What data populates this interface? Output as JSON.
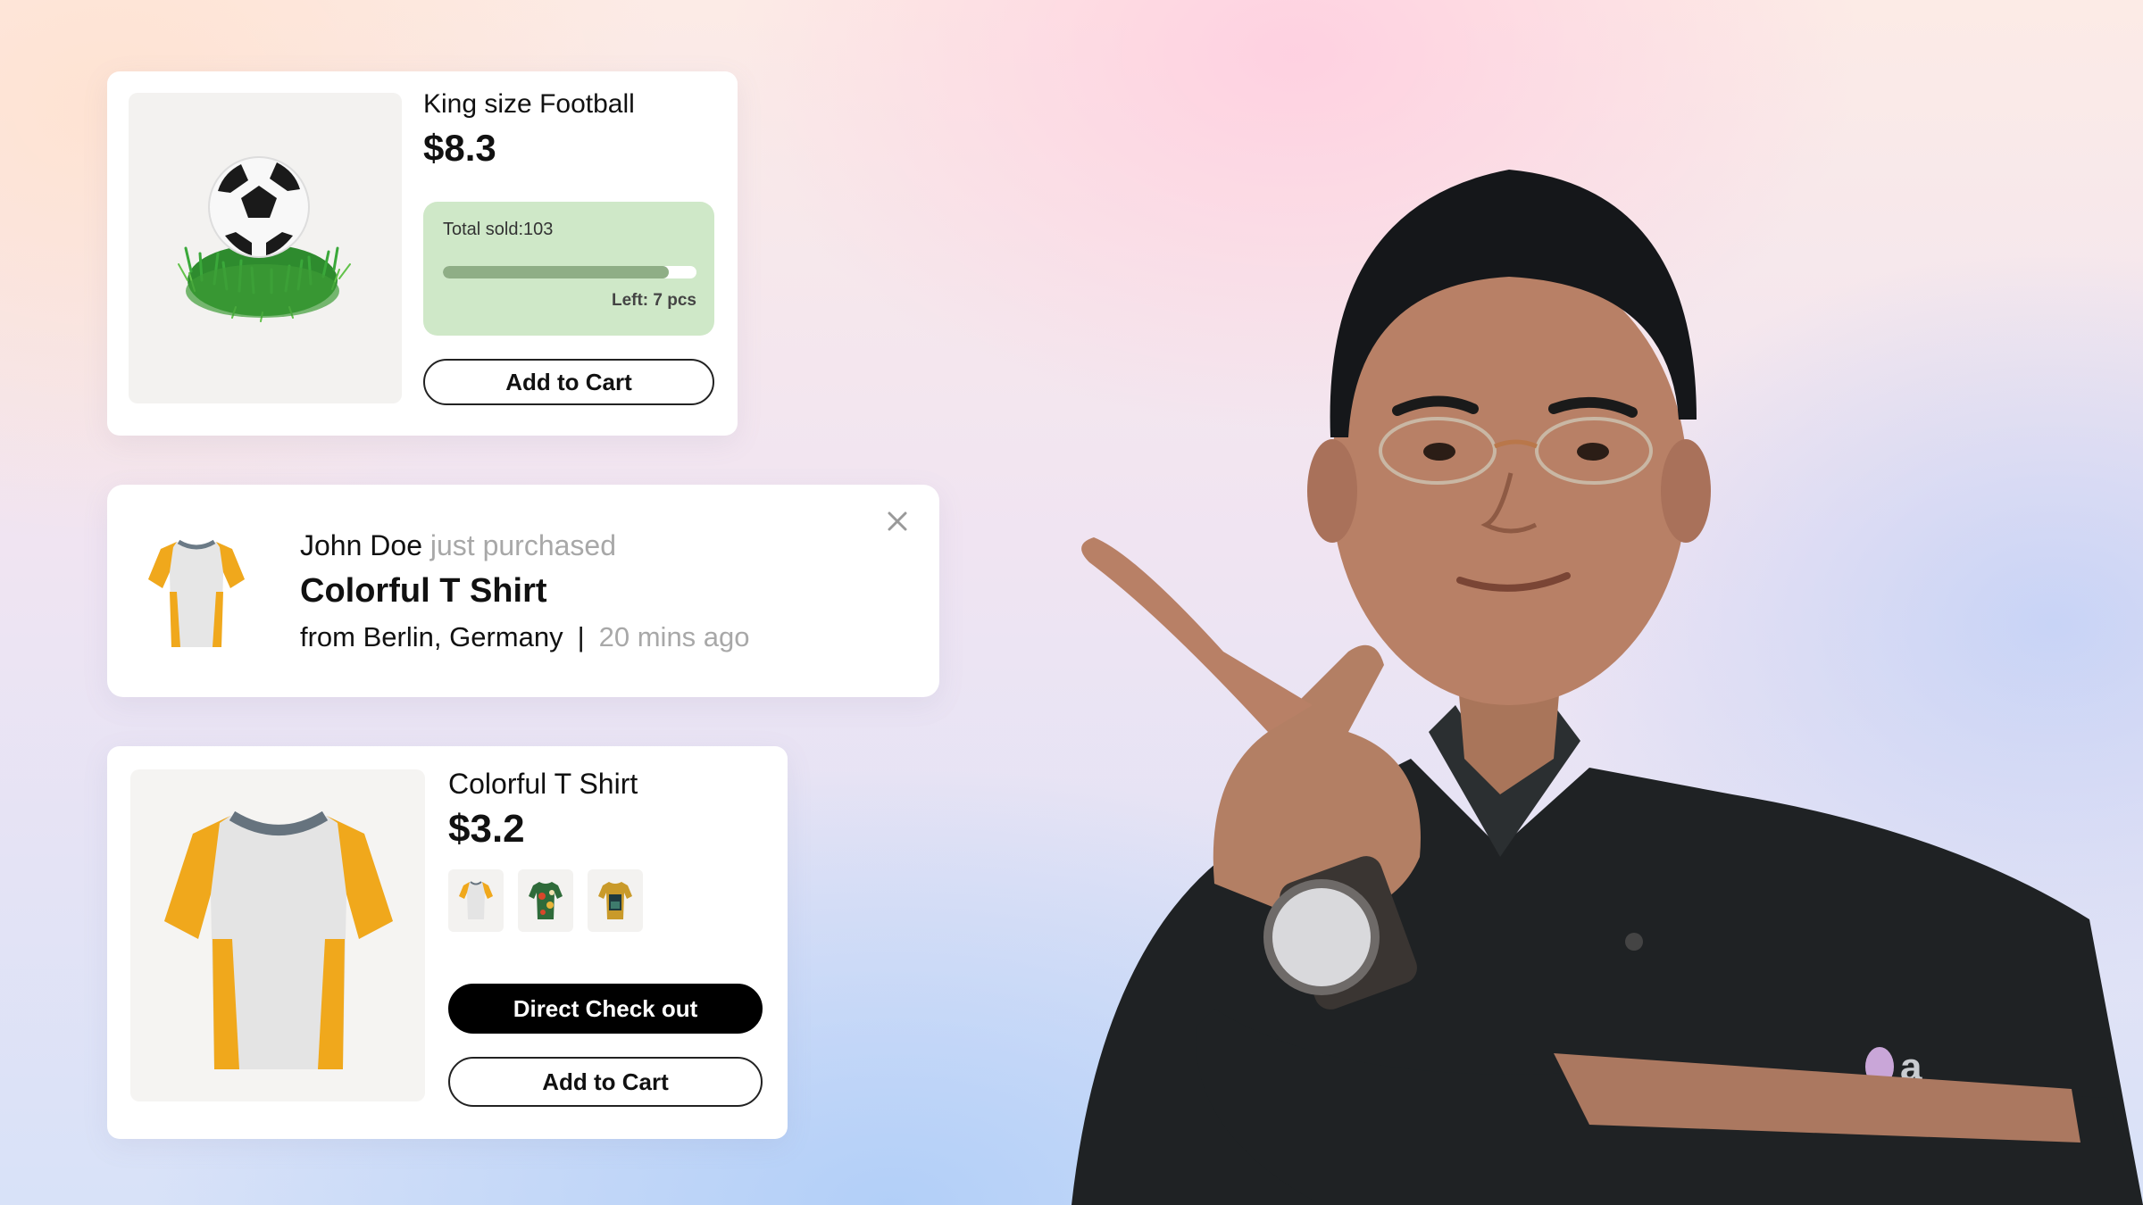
{
  "football_card": {
    "title": "King size Football",
    "price": "$8.3",
    "total_sold": "Total sold:103",
    "stock_left": "Left: 7 pcs",
    "sold_fraction": 0.89,
    "add_to_cart": "Add to Cart",
    "image_icon": "football-on-grass"
  },
  "notification": {
    "buyer_name": "John Doe",
    "action_text": "just purchased",
    "product": "Colorful T Shirt",
    "location": "from Berlin, Germany",
    "separator": "|",
    "time_ago": "20 mins ago",
    "close_icon": "close-icon"
  },
  "shirt_card": {
    "title": "Colorful T Shirt",
    "price": "$3.2",
    "variants": [
      "white-yellow-shirt",
      "floral-shirt",
      "mustard-shirt"
    ],
    "direct_checkout": "Direct Check out",
    "add_to_cart": "Add to Cart"
  },
  "presenter": {
    "logo_fragment": "a"
  },
  "colors": {
    "stock_box": "#cfe8c8",
    "progress_fill": "#8fae86",
    "shirt_yellow": "#f0a81c",
    "muted_text": "#a8a8a8"
  }
}
